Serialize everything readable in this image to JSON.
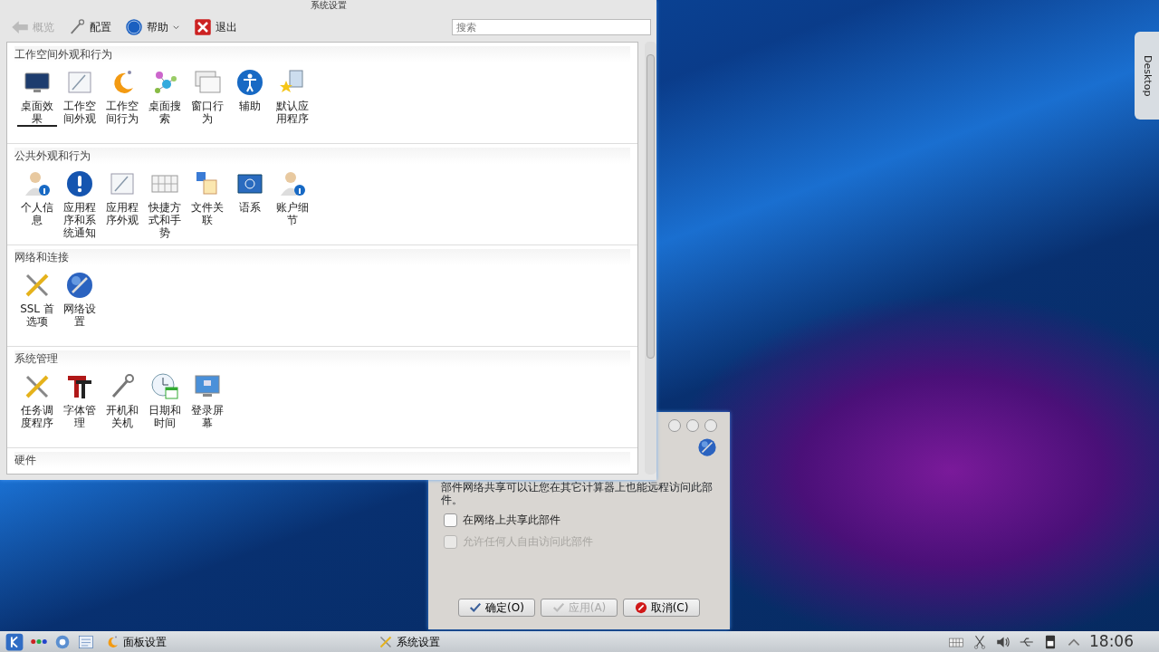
{
  "window": {
    "title": "系统设置"
  },
  "toolbar": {
    "items": [
      {
        "label": "概览",
        "disabled": true,
        "has_menu": false
      },
      {
        "label": "配置",
        "disabled": false,
        "has_menu": false
      },
      {
        "label": "帮助",
        "disabled": false,
        "has_menu": true
      },
      {
        "label": "退出",
        "disabled": false,
        "has_menu": false
      }
    ]
  },
  "search": {
    "placeholder": "搜索"
  },
  "sections": [
    {
      "title": "工作空间外观和行为",
      "items": [
        {
          "label": "桌面效果",
          "selected": true
        },
        {
          "label": "工作空间外观",
          "selected": false
        },
        {
          "label": "工作空间行为",
          "selected": false
        },
        {
          "label": "桌面搜索",
          "selected": false
        },
        {
          "label": "窗口行为",
          "selected": false
        },
        {
          "label": "辅助",
          "selected": false
        },
        {
          "label": "默认应用程序",
          "selected": false
        }
      ]
    },
    {
      "title": "公共外观和行为",
      "items": [
        {
          "label": "个人信息",
          "selected": false
        },
        {
          "label": "应用程序和系统通知",
          "selected": false
        },
        {
          "label": "应用程序外观",
          "selected": false
        },
        {
          "label": "快捷方式和手势",
          "selected": false
        },
        {
          "label": "文件关联",
          "selected": false
        },
        {
          "label": "语系",
          "selected": false
        },
        {
          "label": "账户细节",
          "selected": false
        }
      ]
    },
    {
      "title": "网络和连接",
      "items": [
        {
          "label": "SSL 首选项",
          "selected": false
        },
        {
          "label": "网络设置",
          "selected": false
        }
      ]
    },
    {
      "title": "系统管理",
      "items": [
        {
          "label": "任务调度程序",
          "selected": false
        },
        {
          "label": "字体管理",
          "selected": false
        },
        {
          "label": "开机和关机",
          "selected": false
        },
        {
          "label": "日期和时间",
          "selected": false
        },
        {
          "label": "登录屏幕",
          "selected": false
        }
      ]
    },
    {
      "title": "硬件"
    }
  ],
  "dialog": {
    "description": "部件网络共享可以让您在其它计算器上也能远程访问此部件。",
    "options": [
      {
        "label": "在网络上共享此部件",
        "checked": false,
        "disabled": false
      },
      {
        "label": "允许任何人自由访问此部件",
        "checked": false,
        "disabled": true
      }
    ],
    "buttons": [
      {
        "label": "确定(O)",
        "kind": "ok",
        "disabled": false
      },
      {
        "label": "应用(A)",
        "kind": "apply",
        "disabled": true
      },
      {
        "label": "取消(C)",
        "kind": "cancel",
        "disabled": false
      }
    ]
  },
  "desktop_tab": {
    "label": "Desktop"
  },
  "taskbar": {
    "tasks": [
      {
        "label": "面板设置"
      },
      {
        "label": "系统设置"
      }
    ],
    "clock": "18:06"
  }
}
